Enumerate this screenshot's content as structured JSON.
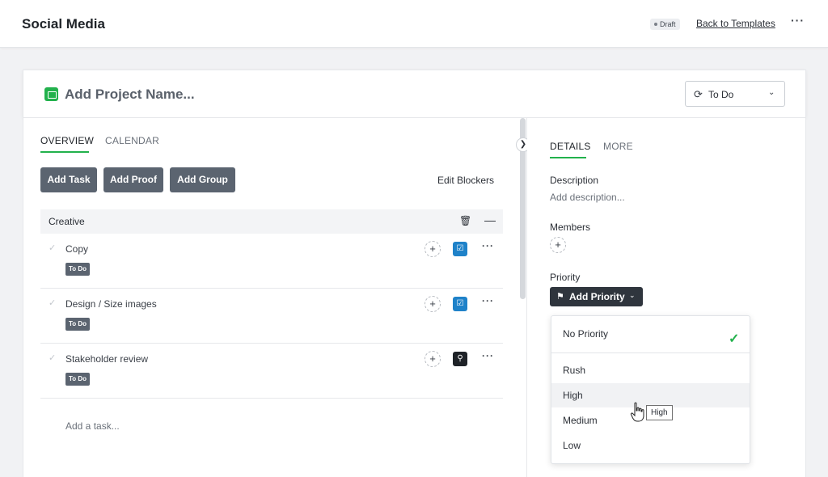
{
  "header": {
    "title": "Social Media",
    "draft_badge": "Draft",
    "back_link": "Back to Templates",
    "more": "···"
  },
  "project": {
    "name_placeholder": "Add Project Name...",
    "status": "To Do",
    "folder_color": "#22b14c"
  },
  "left_tabs": [
    "OVERVIEW",
    "CALENDAR"
  ],
  "toolbar": {
    "add_task": "Add Task",
    "add_proof": "Add Proof",
    "add_group": "Add Group",
    "edit_blockers": "Edit Blockers"
  },
  "group": {
    "name": "Creative",
    "tasks": [
      {
        "name": "Copy",
        "status": "To Do",
        "icon": "task-check-icon",
        "icon_color": "#1f82c9"
      },
      {
        "name": "Design / Size images",
        "status": "To Do",
        "icon": "task-check-icon",
        "icon_color": "#1f82c9"
      },
      {
        "name": "Stakeholder review",
        "status": "To Do",
        "icon": "proof-icon",
        "icon_color": "#1f2328"
      }
    ],
    "add_task": "Add a task..."
  },
  "right_tabs": [
    "DETAILS",
    "MORE"
  ],
  "details": {
    "description_label": "Description",
    "description_placeholder": "Add description...",
    "members_label": "Members",
    "priority_label": "Priority",
    "priority_button": "Add Priority"
  },
  "priority_menu": {
    "options": [
      "No Priority",
      "Rush",
      "High",
      "Medium",
      "Low"
    ],
    "selected": "No Priority",
    "hovered": "High"
  },
  "tooltip": "High",
  "accent_color": "#22b14c"
}
